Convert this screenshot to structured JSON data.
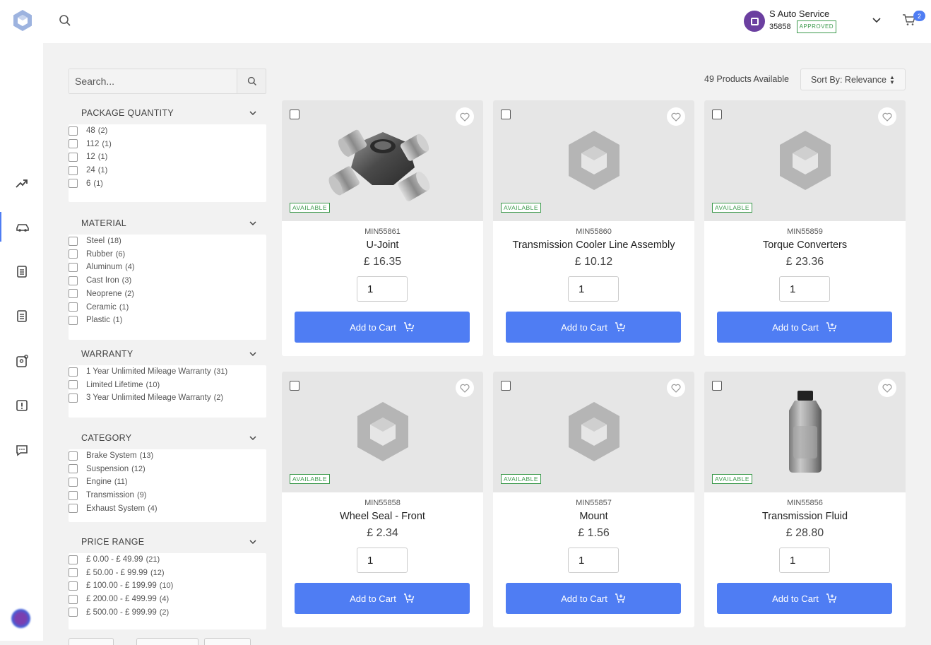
{
  "header": {
    "account_name": "S Auto Service",
    "account_number": "35858",
    "account_status": "APPROVED",
    "cart_count": "2"
  },
  "search": {
    "placeholder": "Search..."
  },
  "toolbar": {
    "products_available": "49 Products Available",
    "sort_label": "Sort By: Relevance"
  },
  "filters": [
    {
      "title": "PACKAGE QUANTITY",
      "options": [
        {
          "label": "48",
          "count": "(2)"
        },
        {
          "label": "112",
          "count": "(1)"
        },
        {
          "label": "12",
          "count": "(1)"
        },
        {
          "label": "24",
          "count": "(1)"
        },
        {
          "label": "6",
          "count": "(1)"
        }
      ]
    },
    {
      "title": "MATERIAL",
      "options": [
        {
          "label": "Steel",
          "count": "(18)"
        },
        {
          "label": "Rubber",
          "count": "(6)"
        },
        {
          "label": "Aluminum",
          "count": "(4)"
        },
        {
          "label": "Cast Iron",
          "count": "(3)"
        },
        {
          "label": "Neoprene",
          "count": "(2)"
        },
        {
          "label": "Ceramic",
          "count": "(1)"
        },
        {
          "label": "Plastic",
          "count": "(1)"
        }
      ]
    },
    {
      "title": "WARRANTY",
      "options": [
        {
          "label": "1 Year Unlimited Mileage Warranty",
          "count": "(31)"
        },
        {
          "label": "Limited Lifetime",
          "count": "(10)"
        },
        {
          "label": "3 Year Unlimited Mileage Warranty",
          "count": "(2)"
        }
      ]
    },
    {
      "title": "CATEGORY",
      "options": [
        {
          "label": "Brake System",
          "count": "(13)"
        },
        {
          "label": "Suspension",
          "count": "(12)"
        },
        {
          "label": "Engine",
          "count": "(11)"
        },
        {
          "label": "Transmission",
          "count": "(9)"
        },
        {
          "label": "Exhaust System",
          "count": "(4)"
        }
      ]
    },
    {
      "title": "PRICE RANGE",
      "options": [
        {
          "label": "£ 0.00 - £ 49.99",
          "count": "(21)"
        },
        {
          "label": "£ 50.00 - £ 99.99",
          "count": "(12)"
        },
        {
          "label": "£ 100.00 - £ 199.99",
          "count": "(10)"
        },
        {
          "label": "£ 200.00 - £ 499.99",
          "count": "(4)"
        },
        {
          "label": "£ 500.00 - £ 999.99",
          "count": "(2)"
        }
      ]
    }
  ],
  "products": [
    {
      "sku": "MIN55861",
      "name": "U-Joint",
      "price": "£ 16.35",
      "qty": "1",
      "availability": "AVAILABLE",
      "add_label": "Add to Cart",
      "image": "u-joint"
    },
    {
      "sku": "MIN55860",
      "name": "Transmission Cooler Line Assembly",
      "price": "£ 10.12",
      "qty": "1",
      "availability": "AVAILABLE",
      "add_label": "Add to Cart",
      "image": "placeholder"
    },
    {
      "sku": "MIN55859",
      "name": "Torque Converters",
      "price": "£ 23.36",
      "qty": "1",
      "availability": "AVAILABLE",
      "add_label": "Add to Cart",
      "image": "placeholder"
    },
    {
      "sku": "MIN55858",
      "name": "Wheel Seal - Front",
      "price": "£ 2.34",
      "qty": "1",
      "availability": "AVAILABLE",
      "add_label": "Add to Cart",
      "image": "placeholder"
    },
    {
      "sku": "MIN55857",
      "name": "Mount",
      "price": "£ 1.56",
      "qty": "1",
      "availability": "AVAILABLE",
      "add_label": "Add to Cart",
      "image": "placeholder"
    },
    {
      "sku": "MIN55856",
      "name": "Transmission Fluid",
      "price": "£ 28.80",
      "qty": "1",
      "availability": "AVAILABLE",
      "add_label": "Add to Cart",
      "image": "fluid-bottle"
    }
  ],
  "colors": {
    "accent": "#4f7df3",
    "available": "#3c9a4c",
    "placeholder_icon": "#b5b5b5"
  }
}
